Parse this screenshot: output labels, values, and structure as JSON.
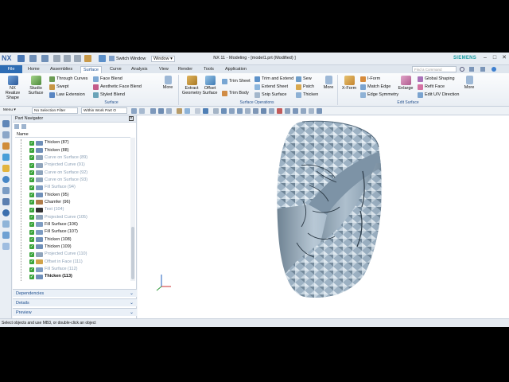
{
  "app": {
    "logo": "NX",
    "window_title": "NX 11 - Modeling - [model1.prt (Modified) ]",
    "brand": "SIEMENS",
    "switch_window": "Switch Window",
    "window_menu": "Window ▾"
  },
  "tabs": {
    "file": "File",
    "items": [
      "Home",
      "Assemblies",
      "Surface",
      "Curve",
      "Analysis",
      "View",
      "Render",
      "Tools",
      "Application"
    ],
    "active": "Surface",
    "find_placeholder": "Find a Command"
  },
  "ribbon": {
    "nx_realize": "NX Realize Shape",
    "studio_surface": "Studio Surface",
    "through_curves": "Through Curves",
    "swept": "Swept",
    "law_extension": "Law Extension",
    "face_blend": "Face Blend",
    "aesthetic_face_blend": "Aesthetic Face Blend",
    "styled_blend": "Styled Blend",
    "more1": "More",
    "surface_group": "Surface",
    "extract_geometry": "Extract Geometry",
    "offset_surface": "Offset Surface",
    "trim_sheet": "Trim Sheet",
    "trim_body": "Trim Body",
    "trim_and_extend": "Trim and Extend",
    "extend_sheet": "Extend Sheet",
    "snip_surface": "Snip Surface",
    "sew": "Sew",
    "patch": "Patch",
    "thicken": "Thicken",
    "more2": "More",
    "surface_operations_group": "Surface Operations",
    "x_form": "X-Form",
    "i_form": "I-Form",
    "match_edge": "Match Edge",
    "edge_symmetry": "Edge Symmetry",
    "enlarge": "Enlarge",
    "global_shaping": "Global Shaping",
    "refit_face": "Refit Face",
    "edit_uv_direction": "Edit U/V Direction",
    "more3": "More",
    "edit_surface_group": "Edit Surface"
  },
  "selection_bar": {
    "menu": "Menu ▾",
    "filter": "No Selection Filter",
    "scope": "Within Work Part O"
  },
  "navigator": {
    "title": "Part Navigator",
    "column_name": "Name",
    "items": [
      {
        "label": "Thicken (87)",
        "type": "thicken",
        "suppressed": false,
        "bold": false
      },
      {
        "label": "Thicken (88)",
        "type": "thicken",
        "suppressed": false,
        "bold": false
      },
      {
        "label": "Curve on Surface (89)",
        "type": "curve",
        "suppressed": true,
        "bold": false
      },
      {
        "label": "Projected Curve (91)",
        "type": "curve",
        "suppressed": true,
        "bold": false
      },
      {
        "label": "Curve on Surface (92)",
        "type": "curve",
        "suppressed": true,
        "bold": false
      },
      {
        "label": "Curve on Surface (93)",
        "type": "curve",
        "suppressed": true,
        "bold": false
      },
      {
        "label": "Fill Surface (94)",
        "type": "fill",
        "suppressed": true,
        "bold": false
      },
      {
        "label": "Thicken (95)",
        "type": "thicken",
        "suppressed": false,
        "bold": false
      },
      {
        "label": "Chamfer (96)",
        "type": "chamfer",
        "suppressed": false,
        "bold": false
      },
      {
        "label": "Text (104)",
        "type": "text",
        "suppressed": true,
        "bold": false
      },
      {
        "label": "Projected Curve (105)",
        "type": "curve",
        "suppressed": true,
        "bold": false
      },
      {
        "label": "Fill Surface (106)",
        "type": "fill",
        "suppressed": false,
        "bold": false
      },
      {
        "label": "Fill Surface (107)",
        "type": "fill",
        "suppressed": false,
        "bold": false
      },
      {
        "label": "Thicken (108)",
        "type": "thicken",
        "suppressed": false,
        "bold": false
      },
      {
        "label": "Thicken (109)",
        "type": "thicken",
        "suppressed": false,
        "bold": false
      },
      {
        "label": "Projected Curve (110)",
        "type": "curve",
        "suppressed": true,
        "bold": false
      },
      {
        "label": "Offset in Face (111)",
        "type": "offset",
        "suppressed": true,
        "bold": false
      },
      {
        "label": "Fill Surface (112)",
        "type": "fill",
        "suppressed": true,
        "bold": false
      },
      {
        "label": "Thicken (113)",
        "type": "thicken",
        "suppressed": false,
        "bold": true
      }
    ],
    "panels": [
      "Dependencies",
      "Details",
      "Preview"
    ]
  },
  "status": {
    "text": "Select objects and use MB3, or double-click an object"
  },
  "colors": {
    "accent": "#2e6db4",
    "model": "#9fb3c4",
    "checkmark": "#3aa33a"
  }
}
